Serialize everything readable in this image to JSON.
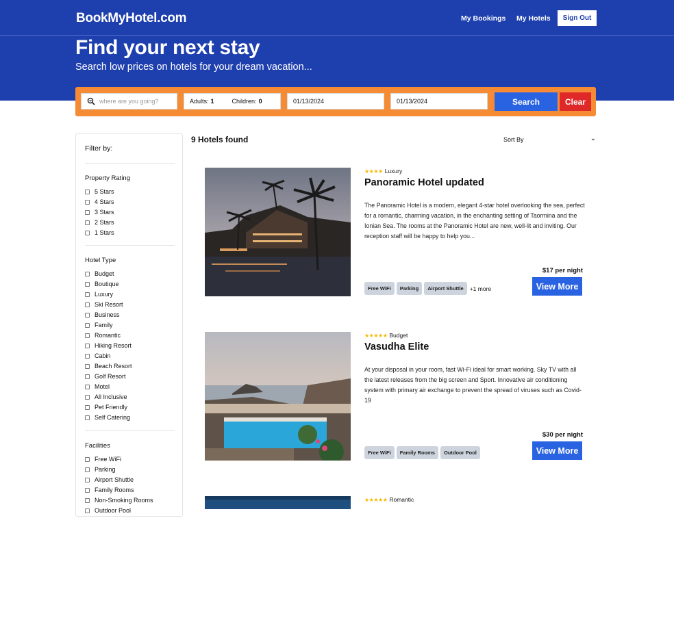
{
  "header": {
    "logo": "BookMyHotel.com",
    "nav": [
      "My Bookings",
      "My Hotels"
    ],
    "sign_out": "Sign Out",
    "hero_title": "Find your next stay",
    "hero_subtitle": "Search low prices on hotels for your dream vacation..."
  },
  "search": {
    "destination_placeholder": "where are you going?",
    "adults_label": "Adults:",
    "adults_value": "1",
    "children_label": "Children:",
    "children_value": "0",
    "check_in": "01/13/2024",
    "check_out": "01/13/2024",
    "search_label": "Search",
    "clear_label": "Clear"
  },
  "filters": {
    "title": "Filter by:",
    "rating_title": "Property Rating",
    "ratings": [
      "5 Stars",
      "4 Stars",
      "3 Stars",
      "2 Stars",
      "1 Stars"
    ],
    "type_title": "Hotel Type",
    "types": [
      "Budget",
      "Boutique",
      "Luxury",
      "Ski Resort",
      "Business",
      "Family",
      "Romantic",
      "Hiking Resort",
      "Cabin",
      "Beach Resort",
      "Golf Resort",
      "Motel",
      "All Inclusive",
      "Pet Friendly",
      "Self Catering"
    ],
    "facilities_title": "Facilities",
    "facilities": [
      "Free WiFi",
      "Parking",
      "Airport Shuttle",
      "Family Rooms",
      "Non-Smoking Rooms",
      "Outdoor Pool"
    ]
  },
  "results": {
    "count_label": "9 Hotels found",
    "sort_label": "Sort By"
  },
  "hotels": [
    {
      "stars": "★★★★",
      "type": "Luxury",
      "name": "Panoramic Hotel updated",
      "description": "The Panoramic Hotel is a modern, elegant 4-star hotel overlooking the sea, perfect for a romantic, charming vacation, in the enchanting setting of Taormina and the Ionian Sea. The rooms at the Panoramic Hotel are new, well-lit and inviting. Our reception staff will be happy to help you...",
      "price": "$17 per night",
      "view_label": "View More",
      "facilities": [
        "Free WiFi",
        "Parking",
        "Airport Shuttle"
      ],
      "more": "+1 more"
    },
    {
      "stars": "★★★★★",
      "type": "Budget",
      "name": "Vasudha Elite",
      "description": "At your disposal in your room, fast Wi-Fi ideal for smart working. Sky TV with all the latest releases from the big screen and Sport. Innovative air conditioning system with primary air exchange to prevent the spread of viruses such as Covid-19",
      "price": "$30 per night",
      "view_label": "View More",
      "facilities": [
        "Free WiFi",
        "Family Rooms",
        "Outdoor Pool"
      ],
      "more": ""
    },
    {
      "stars": "★★★★★",
      "type": "Romantic"
    }
  ],
  "colors": {
    "brand_blue": "#1e3fae",
    "search_orange": "#f58b35",
    "button_blue": "#2a63e2",
    "clear_red": "#df2828",
    "star_yellow": "#f5b800"
  }
}
